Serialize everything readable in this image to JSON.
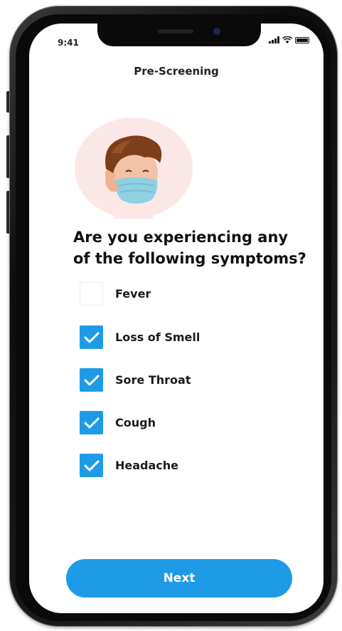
{
  "status_bar": {
    "time": "9:41"
  },
  "header": {
    "title": "Pre-Screening"
  },
  "question": "Are you experiencing any of the following symptoms?",
  "symptoms": [
    {
      "label": "Fever",
      "checked": false
    },
    {
      "label": "Loss of Smell",
      "checked": true
    },
    {
      "label": "Sore Throat",
      "checked": true
    },
    {
      "label": "Cough",
      "checked": true
    },
    {
      "label": "Headache",
      "checked": true
    }
  ],
  "next_button": {
    "label": "Next"
  },
  "colors": {
    "accent": "#1e9be6",
    "avatar_bg": "#fbe8e6",
    "mask": "#8fd0e3"
  },
  "icons": {
    "avatar": "masked-person-avatar",
    "checkbox_checked": "checkmark-icon"
  }
}
